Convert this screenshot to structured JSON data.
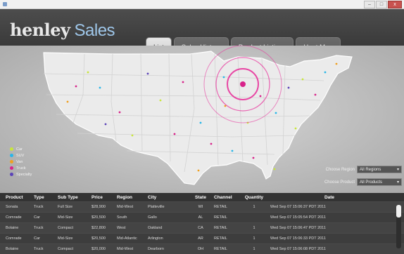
{
  "window": {
    "min": "–",
    "max": "□",
    "close": "x"
  },
  "header": {
    "brand": "henley",
    "product": "Sales"
  },
  "tabs": [
    {
      "label": "List",
      "active": true
    },
    {
      "label": "Sales History",
      "active": false
    },
    {
      "label": "Product Listings",
      "active": false
    },
    {
      "label": "Heat Map",
      "active": false
    }
  ],
  "legend": [
    {
      "label": "Car",
      "color": "#c8e63a"
    },
    {
      "label": "SUV",
      "color": "#29b6e8"
    },
    {
      "label": "Van",
      "color": "#f0a020"
    },
    {
      "label": "Truck",
      "color": "#d8238a"
    },
    {
      "label": "Specialty",
      "color": "#5b43b8"
    }
  ],
  "filters": {
    "region_label": "Choose Region",
    "region_value": "All Regions",
    "product_label": "Choose Product",
    "product_value": "All Products"
  },
  "table": {
    "columns": [
      "Product",
      "Type",
      "Sub Type",
      "Price",
      "Region",
      "City",
      "State",
      "Channel",
      "Quantity",
      "Date"
    ],
    "rows": [
      [
        "Sonata",
        "Truck",
        "Full Size",
        "$28,900",
        "Mid-West",
        "Platteville",
        "WI",
        "RETAIL",
        "1",
        "Wed Sep 07 15:06:37 PDT 2011"
      ],
      [
        "Comrade",
        "Car",
        "Mid-Size",
        "$20,500",
        "South",
        "Gallo",
        "AL",
        "RETAIL",
        "",
        "Wed Sep 07 15:05:54 PDT 2011"
      ],
      [
        "Bolaine",
        "Truck",
        "Compact",
        "$22,800",
        "West",
        "Oakland",
        "CA",
        "RETAIL",
        "1",
        "Wed Sep 07 15:06:47 PDT 2011"
      ],
      [
        "Comrade",
        "Car",
        "Mid-Size",
        "$20,500",
        "Mid-Atlantic",
        "Arlington",
        "AR",
        "RETAIL",
        "1",
        "Wed Sep 07 15:06:33 PDT 2011"
      ],
      [
        "Bolaine",
        "Truck",
        "Compact",
        "$20,000",
        "Mid-West",
        "Dearborn",
        "OH",
        "RETAIL",
        "1",
        "Wed Sep 07 15:06:08 PDT 2011"
      ]
    ]
  }
}
